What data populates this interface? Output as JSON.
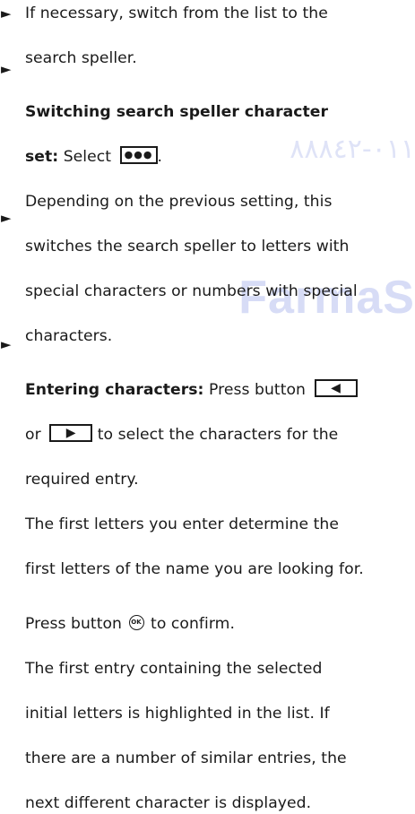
{
  "watermark": {
    "logo": "FarmaS",
    "arabic_logo": "٠١١-٨٨٨٤٢"
  },
  "steps": [
    {
      "lines": [
        {
          "text": "If necessary, switch from the list to the"
        },
        {
          "text": "search speller."
        }
      ]
    },
    {
      "title": "Switching search speller character",
      "title_cont": "set:",
      "select_label": "Select",
      "key_dots": "●●●",
      "period": ".",
      "body": [
        "Depending on the previous setting, this",
        "switches the search speller to letters with",
        "special characters or numbers with special",
        "characters."
      ]
    },
    {
      "title": "Entering characters:",
      "press_label": "Press button",
      "left_arrow": "◀",
      "or_label": "or",
      "right_arrow": "▶",
      "select_rest": "to select the characters for the",
      "line3": "required entry.",
      "body": [
        "The first letters you enter determine the",
        "first letters of the name you are looking for."
      ]
    },
    {
      "press_label": "Press button",
      "ok_label": "OK",
      "confirm": "to confirm.",
      "body": [
        "The first entry containing the selected",
        "initial letters is highlighted in the list. If",
        "there are a number of similar entries, the",
        "next different character is displayed."
      ]
    }
  ],
  "bullet_glyph": "►"
}
